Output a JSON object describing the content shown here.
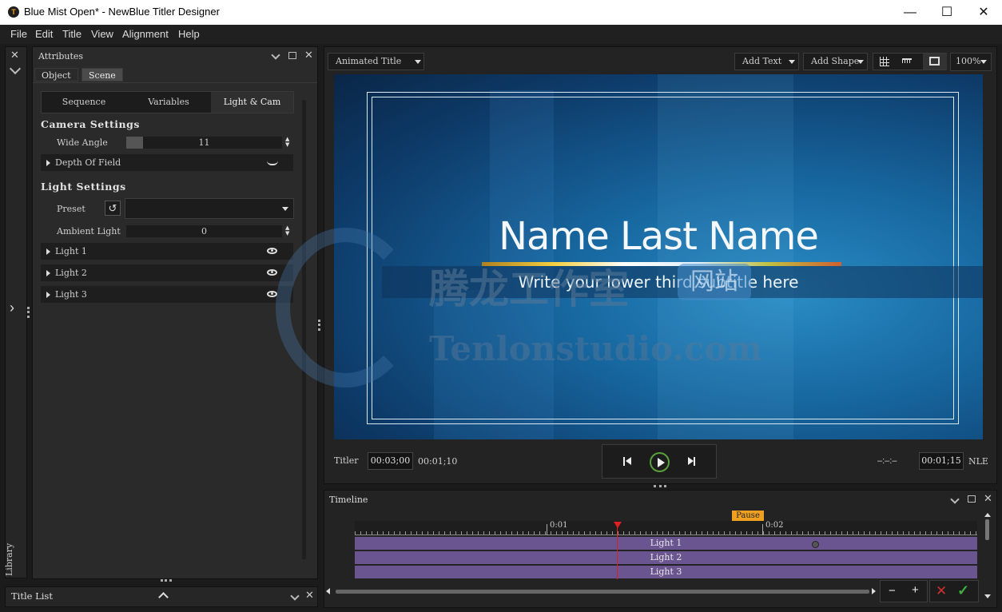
{
  "window": {
    "title": "Blue Mist Open* - NewBlue Titler Designer",
    "app_icon_glyph": "T",
    "minimize": "—",
    "maximize": "☐",
    "close": "✕"
  },
  "menu": [
    "File",
    "Edit",
    "Title",
    "View",
    "Alignment",
    "Help"
  ],
  "left_strip": {
    "library_label": "Library"
  },
  "attributes": {
    "panel_title": "Attributes",
    "tabs": [
      "Object",
      "Scene"
    ],
    "active_tab": "Scene",
    "segments": [
      "Sequence",
      "Variables",
      "Light & Cam"
    ],
    "active_segment": "Light & Cam",
    "camera_heading": "Camera Settings",
    "wide_angle_label": "Wide Angle",
    "wide_angle_value": "11",
    "depth_of_field_label": "Depth Of Field",
    "light_heading": "Light Settings",
    "preset_label": "Preset",
    "preset_value": "",
    "ambient_label": "Ambient Light",
    "ambient_value": "0",
    "lights": [
      "Light 1",
      "Light 2",
      "Light 3"
    ]
  },
  "title_list": {
    "label": "Title List"
  },
  "preview": {
    "title_type": "Animated Title",
    "add_text": "Add Text",
    "add_shape": "Add Shape",
    "zoom": "100%",
    "headline": "Name Last Name",
    "subtitle": "Write your lower third subtitle here",
    "watermark_cn": "腾龙工作室",
    "watermark_cn2": "网站",
    "watermark_en": "Tenlonstudio.com"
  },
  "transport": {
    "titler_label": "Titler",
    "titler_time": "00:03;00",
    "current_time": "00:01;10",
    "out_placeholder": "–:–:–",
    "out_time": "00:01;15",
    "nle_label": "NLE"
  },
  "timeline": {
    "panel_title": "Timeline",
    "pause_marker": "Pause",
    "ruler_labels": [
      "0:01",
      "0:02"
    ],
    "tracks": [
      "Light 1",
      "Light 2",
      "Light 3"
    ],
    "zoom_out": "−",
    "zoom_in": "+"
  },
  "colors": {
    "accent_orange": "#f0a020",
    "track_purple": "#6b5590",
    "playhead_red": "#e02020",
    "cancel_red": "#d03030",
    "confirm_green": "#40b040"
  }
}
